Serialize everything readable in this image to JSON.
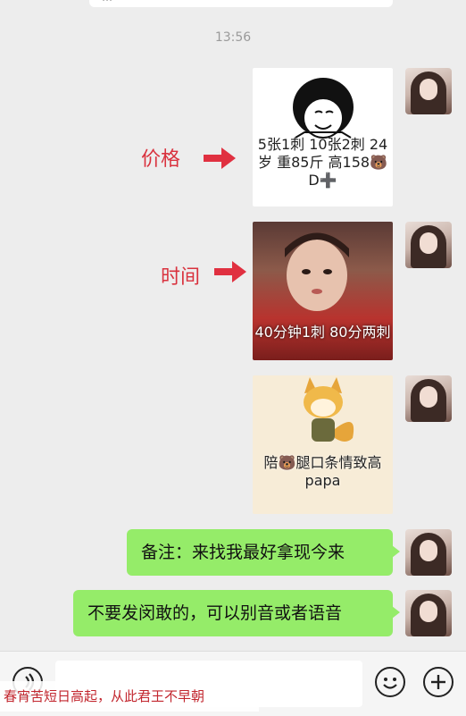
{
  "chat": {
    "timestamp": "13:56",
    "annotations": {
      "price": "价格",
      "time": "时间"
    },
    "image_messages": [
      {
        "caption": "5张1刺 10张2刺 24岁 重85斤 高158🐻D➕"
      },
      {
        "caption": "40分钟1刺 80分两刺"
      },
      {
        "caption": "陪🐻腿口条情致高papa"
      }
    ],
    "text_messages": [
      {
        "text": "备注：来找我最好拿现今来"
      },
      {
        "text": "不要发闵敢的，可以别音或者语音"
      }
    ]
  },
  "input_bar": {
    "voice_icon": "voice-icon",
    "emoji_icon": "emoji-icon",
    "plus_icon": "plus-icon"
  },
  "overlay": {
    "poem": "春宵苦短日高起，从此君王不早朝"
  },
  "colors": {
    "accent_green": "#95ec69",
    "label_red": "#d9323e",
    "background": "#ededed"
  }
}
